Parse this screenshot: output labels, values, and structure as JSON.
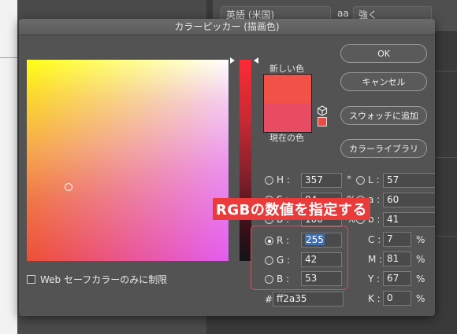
{
  "background": {
    "top_right_field1": "英語 (米国)",
    "top_right_symbol": "aa",
    "top_right_field2": "強く"
  },
  "dialog": {
    "title": "カラーピッカー (描画色)",
    "new_label": "新しい色",
    "current_label": "現在の色",
    "new_color": "#f25148",
    "current_color": "#e84c62",
    "buttons": {
      "ok": "OK",
      "cancel": "キャンセル",
      "add_swatch": "スウォッチに追加",
      "color_library": "カラーライブラリ"
    },
    "hsb": {
      "h_label": "H :",
      "h_value": "357",
      "h_unit": "°",
      "s_label": "S :",
      "s_value": "84",
      "s_unit": "%",
      "b_label": "B :",
      "b_value": "100",
      "b_unit": "%"
    },
    "lab": {
      "l_label": "L :",
      "l_value": "57",
      "a_label": "a :",
      "a_value": "60",
      "b_label": "b :",
      "b_value": "41"
    },
    "rgb": {
      "r_label": "R :",
      "r_value": "255",
      "g_label": "G :",
      "g_value": "42",
      "b_label": "B :",
      "b_value": "53"
    },
    "cmyk": {
      "c_label": "C :",
      "c_value": "7",
      "c_unit": "%",
      "m_label": "M :",
      "m_value": "81",
      "m_unit": "%",
      "y_label": "Y :",
      "y_value": "67",
      "y_unit": "%",
      "k_label": "K :",
      "k_value": "0",
      "k_unit": "%"
    },
    "hex_label": "#",
    "hex_value": "ff2a35",
    "websafe_label": "Web セーフカラーのみに制限",
    "selected_mode": "R"
  },
  "annotation": {
    "callout_text": "RGBの数値を指定する",
    "color": "#ea3a3a"
  }
}
